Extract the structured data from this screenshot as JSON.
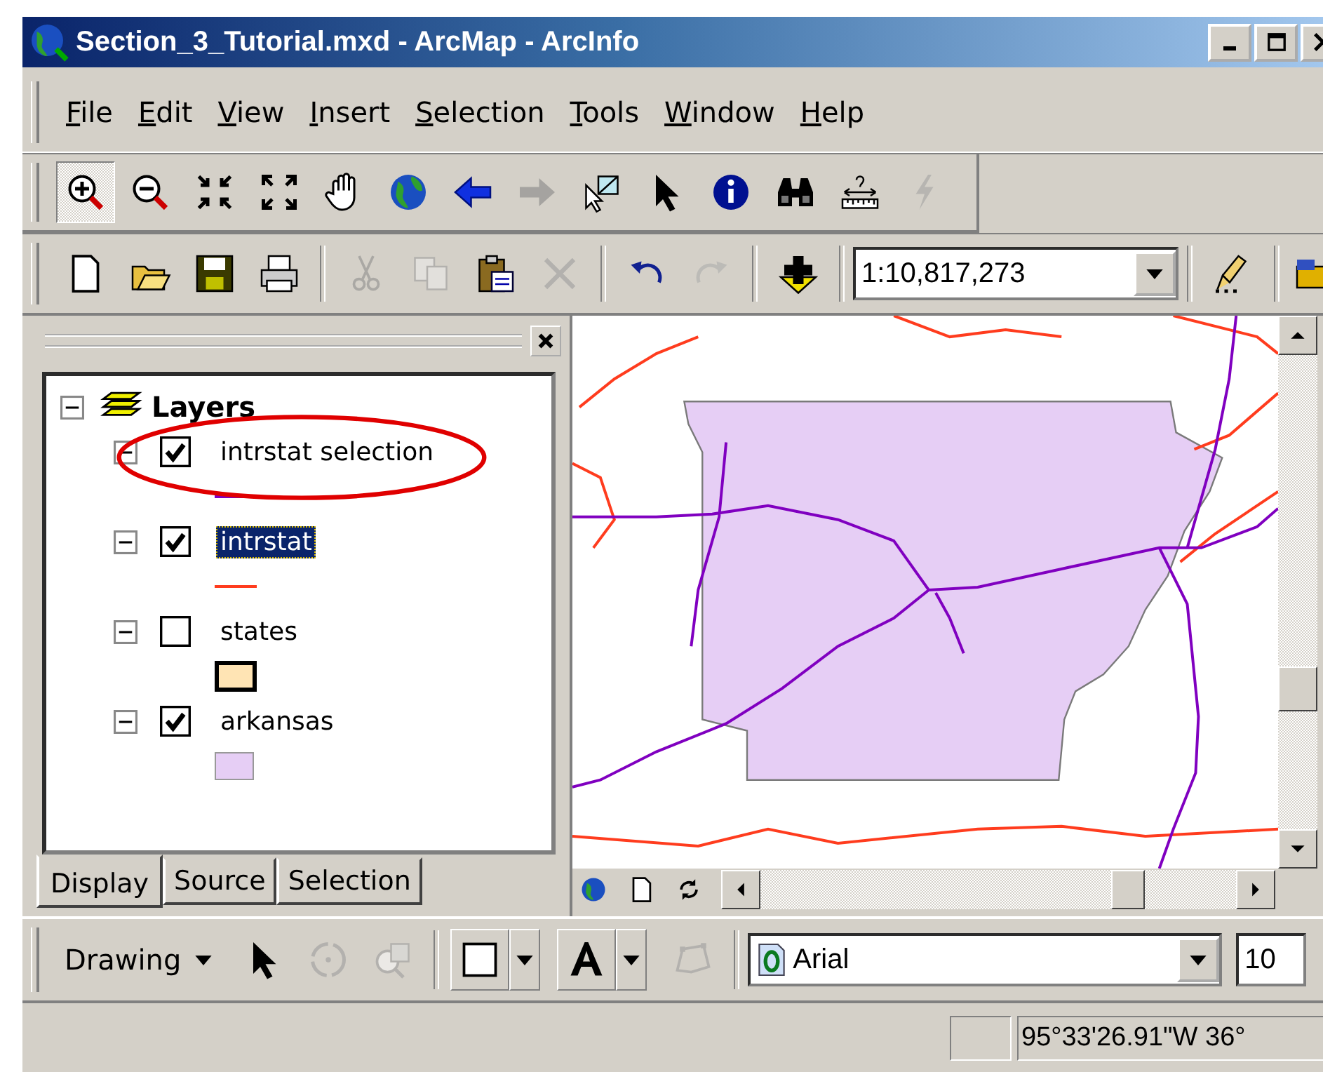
{
  "window": {
    "title": "Section_3_Tutorial.mxd - ArcMap - ArcInfo"
  },
  "menu": [
    "File",
    "Edit",
    "View",
    "Insert",
    "Selection",
    "Tools",
    "Window",
    "Help"
  ],
  "tools_toolbar": [
    {
      "kind": "zoom-in",
      "selected": true,
      "disabled": false
    },
    {
      "kind": "zoom-out",
      "selected": false,
      "disabled": false
    },
    {
      "kind": "fixed-zoom-in",
      "selected": false,
      "disabled": false
    },
    {
      "kind": "fixed-zoom-out",
      "selected": false,
      "disabled": false
    },
    {
      "kind": "pan",
      "selected": false,
      "disabled": false
    },
    {
      "kind": "globe",
      "selected": false,
      "disabled": false
    },
    {
      "kind": "back",
      "selected": false,
      "disabled": false
    },
    {
      "kind": "forward",
      "selected": false,
      "disabled": true
    },
    {
      "kind": "select-elements",
      "selected": false,
      "disabled": false
    },
    {
      "kind": "pointer",
      "selected": false,
      "disabled": false
    },
    {
      "kind": "identify",
      "selected": false,
      "disabled": false
    },
    {
      "kind": "find",
      "selected": false,
      "disabled": false
    },
    {
      "kind": "measure",
      "selected": false,
      "disabled": false
    },
    {
      "kind": "hyperlink",
      "selected": false,
      "disabled": true
    }
  ],
  "standard_toolbar": [
    {
      "kind": "new",
      "disabled": false
    },
    {
      "kind": "open",
      "disabled": false
    },
    {
      "kind": "save",
      "disabled": false
    },
    {
      "kind": "print",
      "disabled": false
    },
    {
      "kind": "sep"
    },
    {
      "kind": "cut",
      "disabled": true
    },
    {
      "kind": "copy",
      "disabled": true
    },
    {
      "kind": "paste",
      "disabled": false
    },
    {
      "kind": "delete",
      "disabled": true
    },
    {
      "kind": "sep"
    },
    {
      "kind": "undo",
      "disabled": false
    },
    {
      "kind": "redo",
      "disabled": true
    },
    {
      "kind": "sep"
    },
    {
      "kind": "add-data",
      "disabled": false
    }
  ],
  "scale": {
    "value": "1:10,817,273"
  },
  "toc": {
    "root": "Layers",
    "expanded": true,
    "layers": [
      {
        "name": "intrstat selection",
        "checked": true,
        "selected": false,
        "expanded": true,
        "kind": "line",
        "color": "#8000c0"
      },
      {
        "name": "intrstat",
        "checked": true,
        "selected": true,
        "expanded": true,
        "kind": "line",
        "color": "#ff3c1e"
      },
      {
        "name": "states",
        "checked": false,
        "selected": false,
        "expanded": true,
        "kind": "fill",
        "color": "#ffe4b4"
      },
      {
        "name": "arkansas",
        "checked": true,
        "selected": false,
        "expanded": true,
        "kind": "fill",
        "color": "#e6cef5"
      }
    ]
  },
  "tabs": [
    {
      "label": "Display",
      "selected": true
    },
    {
      "label": "Source",
      "selected": false
    },
    {
      "label": "Selection",
      "selected": false
    }
  ],
  "drawing_toolbar": {
    "label": "Drawing",
    "tools": [
      {
        "kind": "pointer",
        "disabled": false
      },
      {
        "kind": "rotate",
        "disabled": true
      },
      {
        "kind": "zoom-selected",
        "disabled": true
      },
      {
        "kind": "sep"
      },
      {
        "kind": "fill-color",
        "disabled": false
      },
      {
        "kind": "font-color",
        "disabled": false
      },
      {
        "kind": "edit-vertices",
        "disabled": true
      }
    ],
    "font": "Arial",
    "font_size": "10"
  },
  "status_bar": {
    "coordinates": "95°33'26.91\"W  36°"
  }
}
